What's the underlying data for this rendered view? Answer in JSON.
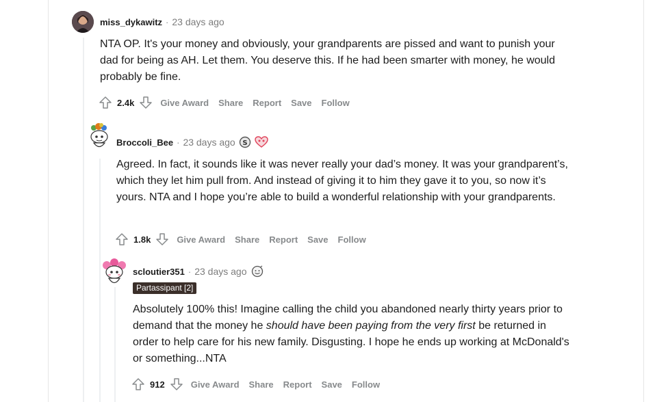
{
  "comments": [
    {
      "username": "miss_dykawitz",
      "separator": "·",
      "time": "23 days ago",
      "paragraphs": [
        "NTA OP. It's your money and obviously, your grandparents are pissed and want to punish your dad for being as AH. Let them. You deserve this. If he had been smarter with money, he would probably be fine."
      ],
      "score": "2.4k",
      "actions": [
        "Give Award",
        "Share",
        "Report",
        "Save",
        "Follow"
      ]
    },
    {
      "username": "Broccoli_Bee",
      "separator": "·",
      "time": "23 days ago",
      "award_icons": [
        "silver-coin-icon",
        "heart-eyes-award-icon"
      ],
      "paragraphs": [
        "Agreed. In fact, it sounds like it was never really your dad’s money. It was your grandparent’s, which they let him pull from. And instead of giving it to him they gave it to you, so now it’s yours. NTA and I hope you’re able to build a wonderful relationship with your grandparents."
      ],
      "score": "1.8k",
      "actions": [
        "Give Award",
        "Share",
        "Report",
        "Save",
        "Follow"
      ]
    },
    {
      "username": "scloutier351",
      "separator": "·",
      "time": "23 days ago",
      "award_icons": [
        "wholesome-award-icon"
      ],
      "flair": "Partassipant [2]",
      "body_parts": {
        "before": "Absolutely 100% this! Imagine calling the child you abandoned nearly thirty years prior to demand that the money he ",
        "italic": "should have been paying from the very first",
        "after": " be returned in order to help care for his new family. Disgusting. I hope he ends up working at McDonald's or something...NTA"
      },
      "score": "912",
      "actions": [
        "Give Award",
        "Share",
        "Report",
        "Save",
        "Follow"
      ]
    }
  ],
  "colors": {
    "text": "#1c1c1c",
    "meta": "#7c7c7c",
    "action": "#878a8c",
    "flair_bg": "#3b2f2a",
    "thread_line": "#edeff1"
  }
}
